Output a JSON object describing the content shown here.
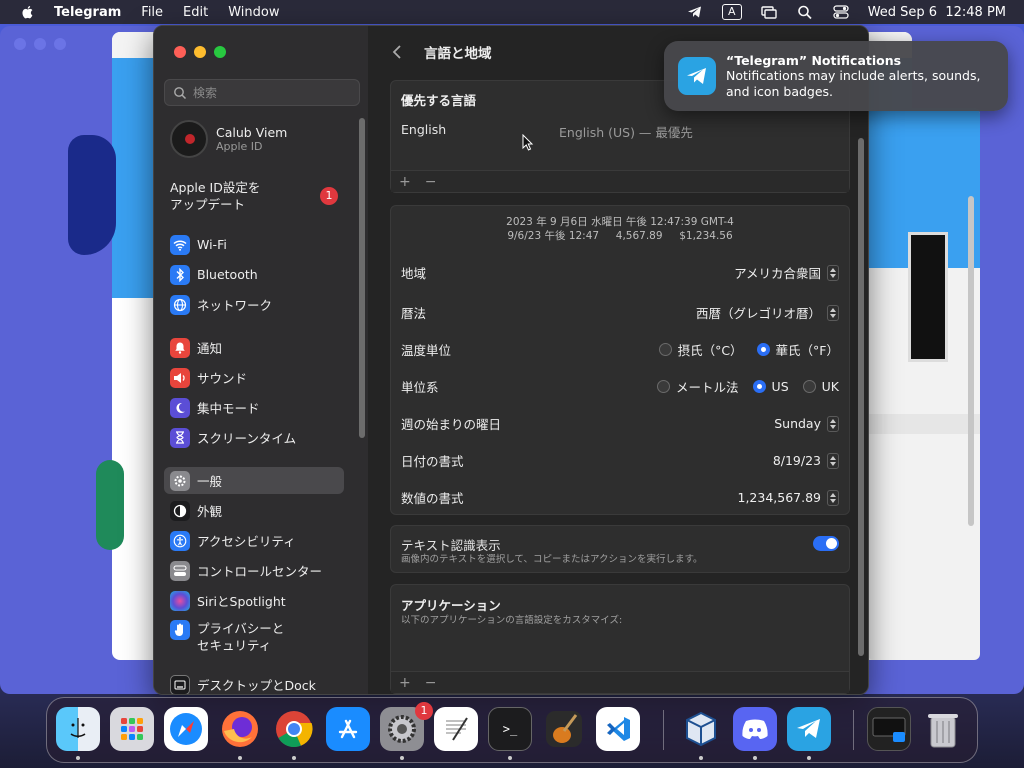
{
  "menubar": {
    "app": "Telegram",
    "items": [
      "File",
      "Edit",
      "Window"
    ],
    "datetime": "Wed Sep 6  12:48 PM",
    "input_indicator": "A"
  },
  "sidebar": {
    "search_placeholder": "検索",
    "profile": {
      "name": "Calub Viem",
      "sub": "Apple ID"
    },
    "update": {
      "label": "Apple ID設定を\nアップデート",
      "badge": "1"
    },
    "items": [
      {
        "label": "Wi-Fi",
        "icon": "wifi-icon",
        "color": "#2a7af5"
      },
      {
        "label": "Bluetooth",
        "icon": "bluetooth-icon",
        "color": "#2a7af5"
      },
      {
        "label": "ネットワーク",
        "icon": "globe-icon",
        "color": "#2a7af5"
      },
      {
        "label": "通知",
        "icon": "bell-icon",
        "color": "#e8453c"
      },
      {
        "label": "サウンド",
        "icon": "speaker-icon",
        "color": "#e8453c"
      },
      {
        "label": "集中モード",
        "icon": "moon-icon",
        "color": "#5b4ed6"
      },
      {
        "label": "スクリーンタイム",
        "icon": "hourglass-icon",
        "color": "#5b4ed6"
      },
      {
        "label": "一般",
        "icon": "gear-icon",
        "color": "#8a8a8e"
      },
      {
        "label": "外観",
        "icon": "appearance-icon",
        "color": "#1c1c1e"
      },
      {
        "label": "アクセシビリティ",
        "icon": "accessibility-icon",
        "color": "#2a7af5"
      },
      {
        "label": "コントロールセンター",
        "icon": "control-center-icon",
        "color": "#8a8a8e"
      },
      {
        "label": "SiriとSpotlight",
        "icon": "siri-icon",
        "color": "#b44ad8"
      },
      {
        "label": "プライバシーと\nセキュリティ",
        "icon": "hand-icon",
        "color": "#2a7af5"
      },
      {
        "label": "デスクトップとDock",
        "icon": "dock-icon",
        "color": "#1c1c1e"
      }
    ]
  },
  "main": {
    "title": "言語と地域",
    "preferred": {
      "header": "優先する言語",
      "language": "English",
      "language_detail": "English (US) — 最優先",
      "add": "+",
      "remove": "−"
    },
    "sample": {
      "line1": "2023 年 9 月6日 水曜日 午後 12:47:39 GMT-4",
      "line2": "9/6/23 午後 12:47     4,567.89     $1,234.56"
    },
    "rows": [
      {
        "label": "地域",
        "value": "アメリカ合衆国"
      },
      {
        "label": "暦法",
        "value": "西暦（グレゴリオ暦）"
      },
      {
        "label": "週の始まりの曜日",
        "value": "Sunday"
      },
      {
        "label": "日付の書式",
        "value": "8/19/23"
      },
      {
        "label": "数値の書式",
        "value": "1,234,567.89"
      }
    ],
    "temperature": {
      "label": "温度単位",
      "options": [
        "摂氏（°C）",
        "華氏（°F）"
      ],
      "selected": 1
    },
    "units": {
      "label": "単位系",
      "options": [
        "メートル法",
        "US",
        "UK"
      ],
      "selected": 1
    },
    "live_text": {
      "title": "テキスト認識表示",
      "desc": "画像内のテキストを選択して、コピーまたはアクションを実行します。",
      "enabled": true
    },
    "apps": {
      "title": "アプリケーション",
      "desc": "以下のアプリケーションの言語設定をカスタマイズ:"
    }
  },
  "notification": {
    "title": "“Telegram” Notifications",
    "body": "Notifications may include alerts, sounds, and icon badges."
  },
  "dock": {
    "items": [
      "Finder",
      "Launchpad",
      "Safari",
      "Firefox",
      "Chrome",
      "App Store",
      "System Settings",
      "TextEdit",
      "Terminal",
      "GarageBand",
      "VS Code",
      "VirtualBox",
      "Discord",
      "Telegram",
      "Screenshot",
      "Trash"
    ],
    "settings_badge": "1"
  }
}
